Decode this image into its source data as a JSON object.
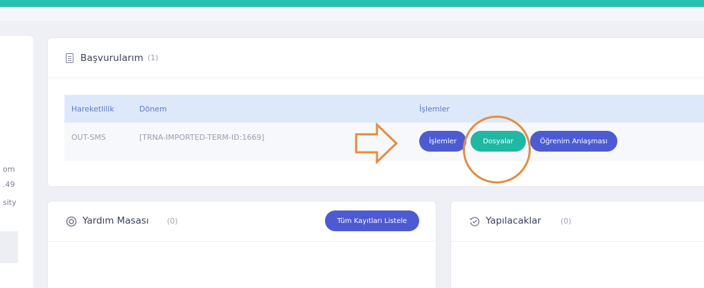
{
  "left_panel": {
    "fragments": [
      "om",
      ".49",
      "sity"
    ]
  },
  "applications": {
    "title": "Başvurularım",
    "count": "(1)",
    "table": {
      "headers": [
        "Hareketlilik",
        "Dönem",
        "İşlemler"
      ],
      "rows": [
        {
          "mobility": "OUT-SMS",
          "term": "[TRNA-IMPORTED-TERM-ID:1669]",
          "actions": [
            "İşlemler",
            "Dosyalar",
            "Öğrenim Anlaşması"
          ]
        }
      ]
    }
  },
  "helpdesk": {
    "title": "Yardım Masası",
    "count": "(0)",
    "list_all_label": "Tüm Kayıtları Listele"
  },
  "todo": {
    "title": "Yapılacaklar",
    "count": "(0)"
  },
  "colors": {
    "accent_teal": "#28c0b1",
    "button_blue": "#4c5bd4",
    "button_teal": "#1fb8a3",
    "annotation_orange": "#e88a3c",
    "table_header_bg": "#dde8fb"
  },
  "icons": {
    "applications": "document-icon",
    "helpdesk": "lifebuoy-icon",
    "todo": "tasks-icon",
    "annotation": "arrow-right-icon"
  }
}
